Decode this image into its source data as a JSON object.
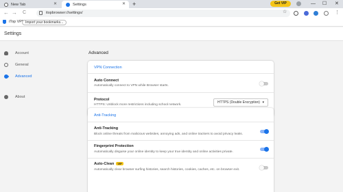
{
  "browser": {
    "tabs": [
      {
        "label": "New Tab"
      },
      {
        "label": "Settings"
      }
    ],
    "new_tab_icon": "+",
    "vip_button": "Get VIP",
    "window_controls": {
      "minimize": "—",
      "maximize": "☐",
      "close": "✕"
    },
    "url": "itopbrowser://settings/",
    "nav_icons": {
      "back": "←",
      "forward": "→",
      "reload": "C"
    }
  },
  "bookmarks": {
    "vpn_label": "iTop VPN",
    "import_label": "Import your bookmarks..."
  },
  "settings": {
    "title": "Settings",
    "sidebar": [
      {
        "label": "Account",
        "icon": "person-icon"
      },
      {
        "label": "General",
        "icon": "gear-icon"
      },
      {
        "label": "Advanced",
        "icon": "rocket-icon",
        "active": true
      },
      {
        "label": "About",
        "icon": "info-icon"
      }
    ],
    "section_title": "Advanced",
    "vpn_card": {
      "heading": "VPN Connection",
      "auto_connect": {
        "title": "Auto Connect",
        "desc": "Automatically connect to VPN while Browser starts.",
        "enabled": false
      },
      "protocol": {
        "title": "Protocol",
        "desc": "HTTPS: Unblock more restrictions including school network.",
        "value": "HTTPS (Double Encryption)"
      }
    },
    "tracking_card": {
      "heading": "Anti-Tracking",
      "anti_tracking": {
        "title": "Anti-Tracking",
        "desc": "Block online threats from malicious websites, annoying ads, and online trackers to avoid privacy leaks.",
        "enabled": true
      },
      "fingerprint": {
        "title": "Fingerprint Protection",
        "desc": "Automatically disguise your online identity to keep your true identity and online activities private.",
        "enabled": true
      },
      "auto_clean": {
        "title": "Auto-Clean",
        "badge": "VIP",
        "desc": "Automatically clear browser surfing histories, search histories, cookies, caches, etc. on browser exit.",
        "enabled": false
      }
    }
  },
  "colors": {
    "accent": "#1a73e8",
    "vip": "#f5c518"
  }
}
